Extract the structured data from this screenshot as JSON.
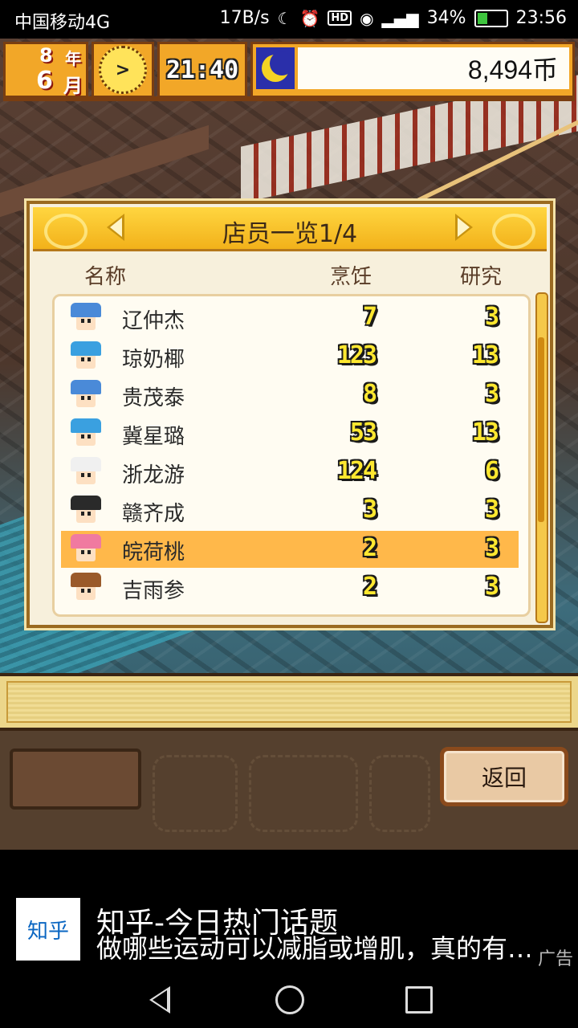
{
  "status_bar": {
    "carrier": "中国移动4G",
    "speed": "17B/s",
    "battery": "34%",
    "battery_level": 0.34,
    "time": "23:56"
  },
  "hud": {
    "month_num": "8",
    "month_label": "年",
    "day_num": "6",
    "day_label": "月",
    "clock_glyph": ">",
    "game_time": "21:40",
    "money": "8,494币"
  },
  "dialog": {
    "title": "店员一览1/4",
    "col_name": "名称",
    "col_cook": "烹饪",
    "col_research": "研究",
    "scroll_position": 0.3,
    "rows": [
      {
        "name": "辽仲杰",
        "cook": "7",
        "research": "3",
        "hair": "#4a8ad8",
        "selected": false
      },
      {
        "name": "琼奶椰",
        "cook": "123",
        "research": "13",
        "hair": "#3aa0e0",
        "selected": false
      },
      {
        "name": "贵茂泰",
        "cook": "8",
        "research": "3",
        "hair": "#4a8ad8",
        "selected": false
      },
      {
        "name": "冀星璐",
        "cook": "53",
        "research": "13",
        "hair": "#3aa0e0",
        "selected": false
      },
      {
        "name": "浙龙游",
        "cook": "124",
        "research": "6",
        "hair": "#f0f0f0",
        "selected": false
      },
      {
        "name": "赣齐成",
        "cook": "3",
        "research": "3",
        "hair": "#2a2a2a",
        "selected": false
      },
      {
        "name": "皖荷桃",
        "cook": "2",
        "research": "3",
        "hair": "#f07aa0",
        "selected": true
      },
      {
        "name": "吉雨参",
        "cook": "2",
        "research": "3",
        "hair": "#9a5a2a",
        "selected": false
      }
    ]
  },
  "bottom": {
    "back_label": "返回"
  },
  "ad": {
    "logo": "知乎",
    "title": "知乎-今日热门话题",
    "subtitle": "做哪些运动可以减脂或增肌，真的有…",
    "tag": "广告"
  },
  "colors": {
    "accent": "#f2a728",
    "selected_row": "#ffb84a",
    "number_fill": "#ffe830"
  },
  "icons": [
    "moon-icon",
    "alarm-icon",
    "hd-icon",
    "eye-icon",
    "signal-icon",
    "battery-icon",
    "clock-icon",
    "arrow-left-icon",
    "arrow-right-icon",
    "nav-back-icon",
    "nav-home-icon",
    "nav-recent-icon"
  ]
}
